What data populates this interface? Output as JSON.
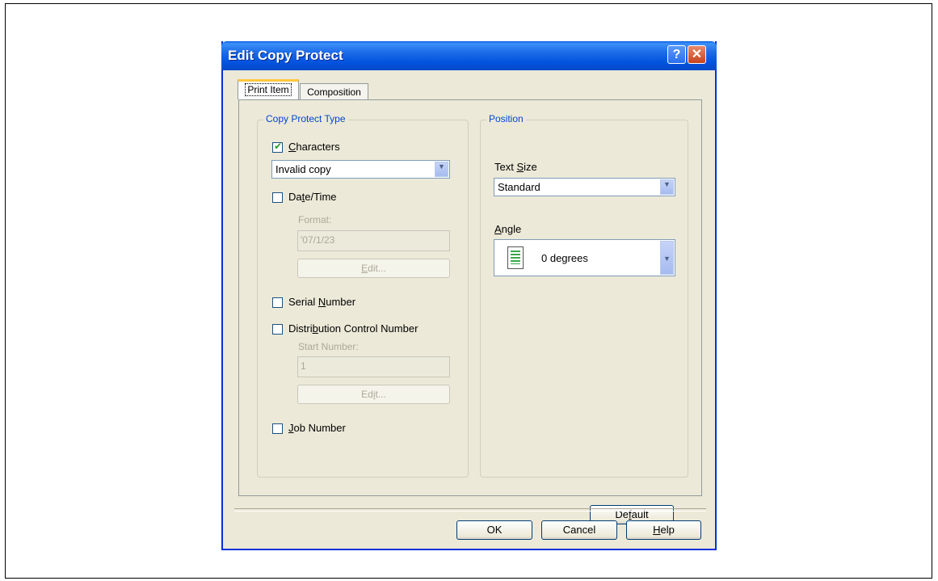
{
  "dialog": {
    "title": "Edit Copy Protect",
    "help_glyph": "?",
    "close_glyph": "✕"
  },
  "tabs": [
    {
      "label": "Print Item",
      "active": true
    },
    {
      "label": "Composition",
      "active": false
    }
  ],
  "copy_protect_type": {
    "legend": "Copy Protect Type",
    "characters": {
      "label": "Characters",
      "checked": true,
      "selected": "Invalid copy"
    },
    "date_time": {
      "label": "Date/Time",
      "checked": false,
      "format_label": "Format:",
      "format_value": "'07/1/23",
      "edit_label": "Edit..."
    },
    "serial_number": {
      "label": "Serial Number",
      "checked": false
    },
    "distribution": {
      "label": "Distribution Control Number",
      "checked": false,
      "start_label": "Start Number:",
      "start_value": "1",
      "edit_label": "Edit..."
    },
    "job_number": {
      "label": "Job Number",
      "checked": false
    }
  },
  "position": {
    "legend": "Position",
    "text_size_label": "Text Size",
    "text_size_value": "Standard",
    "angle_label": "Angle",
    "angle_value": "0 degrees"
  },
  "buttons": {
    "default": "Default",
    "ok": "OK",
    "cancel": "Cancel",
    "help": "Help"
  },
  "colors": {
    "title_bar": "#0454e0",
    "dialog_bg": "#ece9d8",
    "group_legend": "#0046d5"
  }
}
